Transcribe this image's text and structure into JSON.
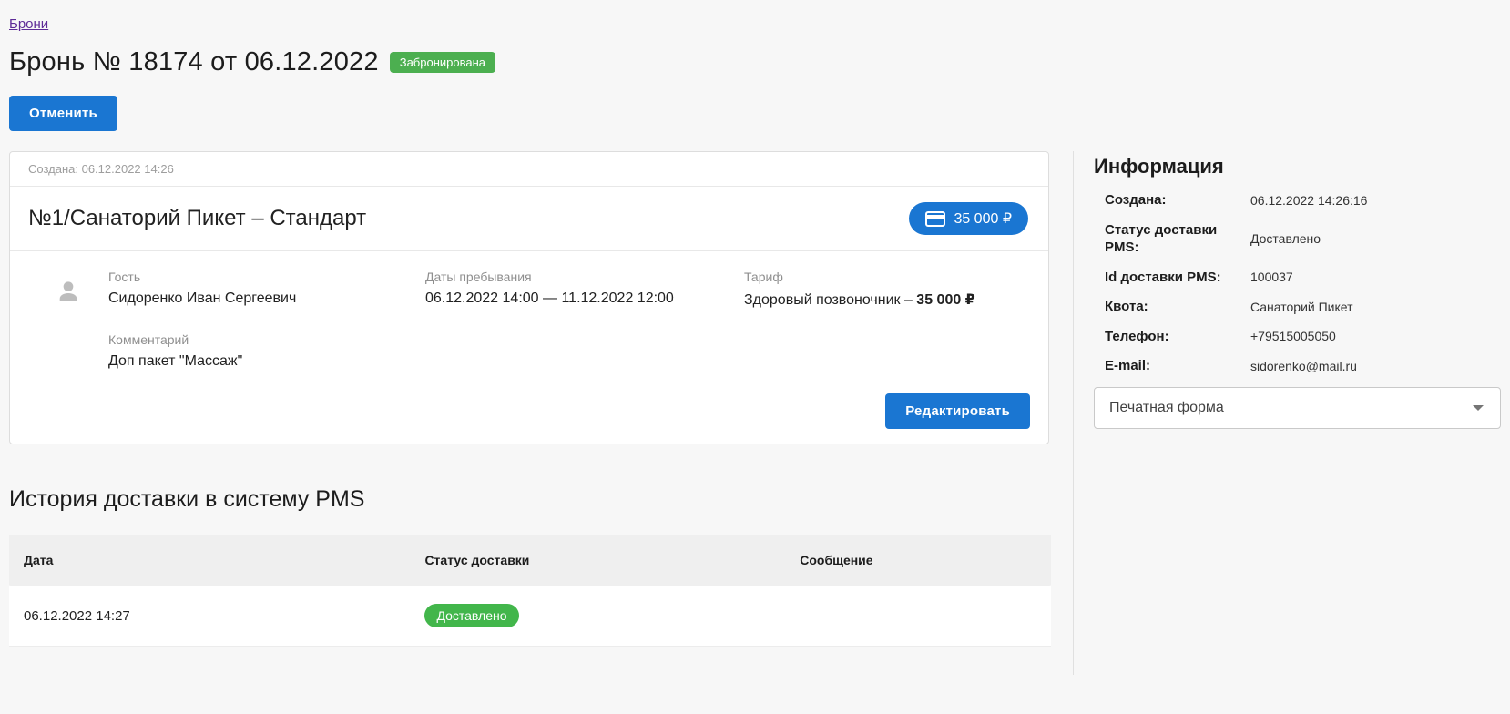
{
  "colors": {
    "accent_blue": "#1a76d2",
    "status_green": "#4caf50",
    "pill_green": "#42b64b",
    "link_purple": "#5e2b97",
    "page_bg": "#f7f7f7"
  },
  "header": {
    "breadcrumb": "Брони",
    "title": "Бронь № 18174 от 06.12.2022",
    "status_badge": "Забронирована",
    "cancel_button": "Отменить"
  },
  "booking_card": {
    "created_line": "Создана: 06.12.2022 14:26",
    "title": "№1/Санаторий Пикет – Стандарт",
    "price_badge": "35 000 ₽",
    "guest": {
      "label": "Гость",
      "value": "Сидоренко Иван Сергеевич"
    },
    "dates": {
      "label": "Даты пребывания",
      "value": "06.12.2022 14:00 — 11.12.2022 12:00"
    },
    "tariff": {
      "label": "Тариф",
      "name": "Здоровый позвоночник – ",
      "price": "35 000 ₽"
    },
    "comment": {
      "label": "Комментарий",
      "value": "Доп пакет \"Массаж\""
    },
    "edit_button": "Редактировать"
  },
  "history": {
    "title": "История доставки в систему PMS",
    "columns": [
      "Дата",
      "Статус доставки",
      "Сообщение"
    ],
    "rows": [
      {
        "date": "06.12.2022 14:27",
        "status": "Доставлено",
        "message": ""
      }
    ]
  },
  "info_panel": {
    "title": "Информация",
    "fields": [
      {
        "label": "Создана:",
        "value": "06.12.2022 14:26:16"
      },
      {
        "label": "Статус доставки PMS:",
        "value": "Доставлено"
      },
      {
        "label": "Id доставки PMS:",
        "value": "100037"
      },
      {
        "label": "Квота:",
        "value": "Санаторий Пикет"
      },
      {
        "label": "Телефон:",
        "value": "+79515005050"
      },
      {
        "label": "E-mail:",
        "value": "sidorenko@mail.ru"
      }
    ],
    "print_form_select": "Печатная форма"
  }
}
